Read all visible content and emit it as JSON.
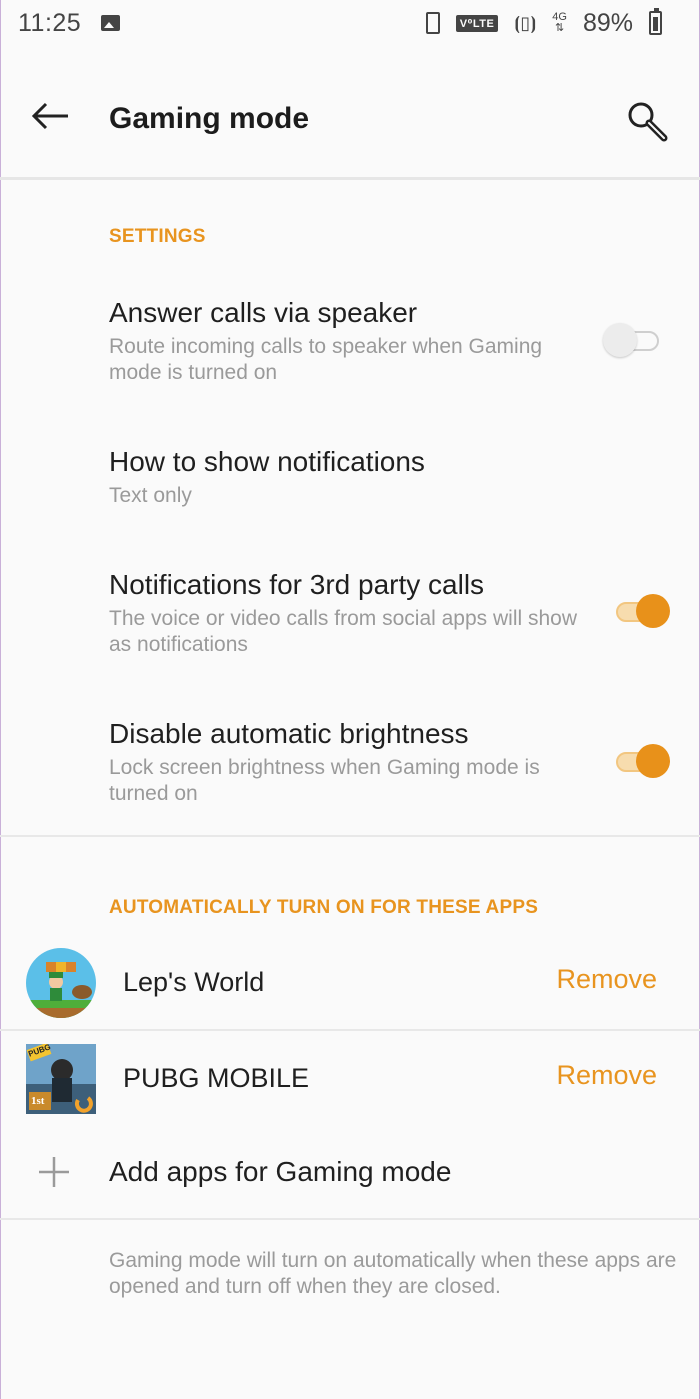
{
  "status_bar": {
    "time": "11:25",
    "volte": "V⁰LTE",
    "network": "4G",
    "battery": "89%"
  },
  "header": {
    "title": "Gaming mode"
  },
  "settings": {
    "section_label": "SETTINGS",
    "items": [
      {
        "title": "Answer calls via speaker",
        "summary": "Route incoming calls to speaker when Gaming mode is turned on",
        "switch_on": false
      },
      {
        "title": "How to show notifications",
        "summary": "Text only"
      },
      {
        "title": "Notifications for 3rd party calls",
        "summary": "The voice or video calls from social apps will show as notifications",
        "switch_on": true
      },
      {
        "title": "Disable automatic brightness",
        "summary": "Lock screen brightness when Gaming mode is turned on",
        "switch_on": true
      }
    ]
  },
  "apps": {
    "section_label": "AUTOMATICALLY TURN ON FOR THESE APPS",
    "items": [
      {
        "name": "Lep's World",
        "action": "Remove"
      },
      {
        "name": "PUBG MOBILE",
        "action": "Remove"
      }
    ],
    "add_label": "Add apps for Gaming mode",
    "footer": "Gaming mode will turn on automatically when these apps are opened and turn off when they are closed."
  },
  "icon_text": {
    "pubg_badge": "PUBG",
    "pubg_rank": "1st"
  },
  "colors": {
    "accent": "#e8941f",
    "background": "#fafafa",
    "summary_text": "#9a9a9a"
  }
}
